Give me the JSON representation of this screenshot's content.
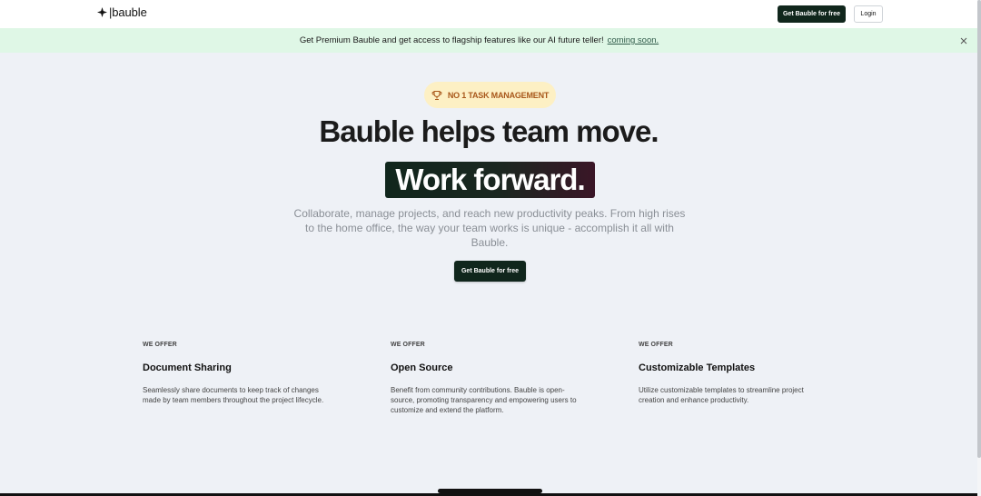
{
  "header": {
    "logo_text": "|bauble",
    "cta_label": "Get Bauble for free",
    "login_label": "Login"
  },
  "banner": {
    "text": "Get Premium Bauble and get access to flagship features like our AI future teller!",
    "link": "coming soon."
  },
  "hero": {
    "badge": "NO 1 TASK MANAGEMENT",
    "title": "Bauble helps team move.",
    "highlight": "Work forward.",
    "description": "Collaborate, manage projects, and reach new productivity peaks. From high rises to the home office, the way your team works is unique - accomplish it all with Bauble.",
    "cta_label": "Get Bauble for free"
  },
  "features": [
    {
      "eyebrow": "WE OFFER",
      "title": "Document Sharing",
      "description": "Seamlessly share documents to keep track of changes made by team members throughout the project lifecycle."
    },
    {
      "eyebrow": "WE OFFER",
      "title": "Open Source",
      "description": "Benefit from community contributions. Bauble is open-source, promoting transparency and empowering users to customize and extend the platform."
    },
    {
      "eyebrow": "WE OFFER",
      "title": "Customizable Templates",
      "description": "Utilize customizable templates to streamline project creation and enhance productivity."
    }
  ],
  "icons": {
    "logo": "diamond-icon",
    "badge": "trophy-icon",
    "banner_close": "close-icon"
  },
  "colors": {
    "primary": "#10261c",
    "banner_bg": "#dff7e6",
    "badge_bg": "#fdf0c4",
    "badge_text": "#a8571a",
    "page_bg": "#eef1f6"
  }
}
